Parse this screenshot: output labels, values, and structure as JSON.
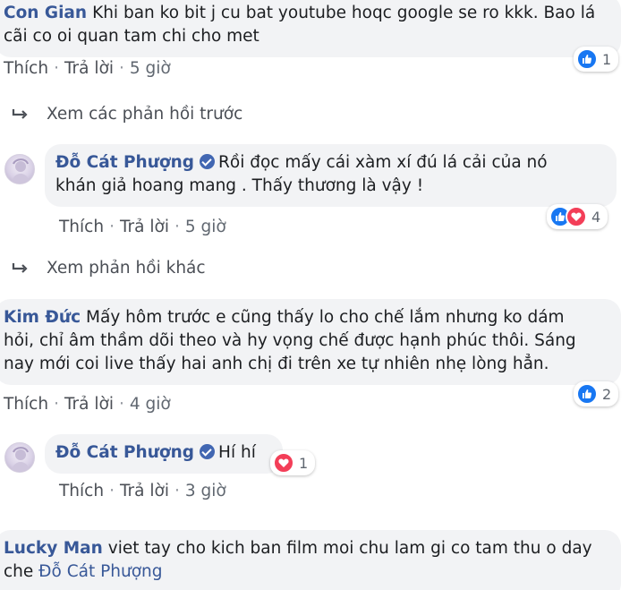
{
  "comments": {
    "c1": {
      "author": "Con Gian",
      "text_line1": "Khi ban ko bit j cu bat youtube hoqc google se ro kkk. Bao lá",
      "text_line2": "cãi co oi quan tam chi cho met",
      "like_label": "Thích",
      "reply_label": "Trả lời",
      "time": "5 giờ",
      "reaction_count": "1"
    },
    "view_prev_replies": "Xem các phản hồi trước",
    "r1": {
      "author": "Đỗ Cát Phượng",
      "text_line1": "Rồi đọc mấy cái xàm xí đú lá cải của nó",
      "text_line2": "khán giả hoang mang . Thấy thương là vậy !",
      "like_label": "Thích",
      "reply_label": "Trả lời",
      "time": "5 giờ",
      "reaction_count": "4"
    },
    "view_other_replies": "Xem phản hồi khác",
    "c2": {
      "author": "Kim Đức",
      "text_line1": "Mấy hôm trước e cũng thấy lo cho chế lắm nhưng ko dám",
      "text_line2": "hỏi, chỉ âm thầm dõi theo và hy vọng chế được hạnh phúc thôi. Sáng",
      "text_line3": "nay mới coi live thấy hai anh chị đi trên xe tự nhiên nhẹ lòng hẳn.",
      "like_label": "Thích",
      "reply_label": "Trả lời",
      "time": "4 giờ",
      "reaction_count": "2"
    },
    "r2": {
      "author": "Đỗ Cát Phượng",
      "text": "Hí hí",
      "like_label": "Thích",
      "reply_label": "Trả lời",
      "time": "3 giờ",
      "reaction_count": "1"
    },
    "c3": {
      "author": "Lucky Man",
      "text_line1": "viet tay cho kich ban film moi chu lam gi co tam thu o day",
      "text_line2_prefix": "che",
      "tagged_name": "Đỗ Cát Phượng"
    }
  },
  "colors": {
    "link_blue": "#385898",
    "bubble_bg": "#f2f3f5",
    "like_blue": "#1877f2",
    "love_red": "#f33e58"
  }
}
